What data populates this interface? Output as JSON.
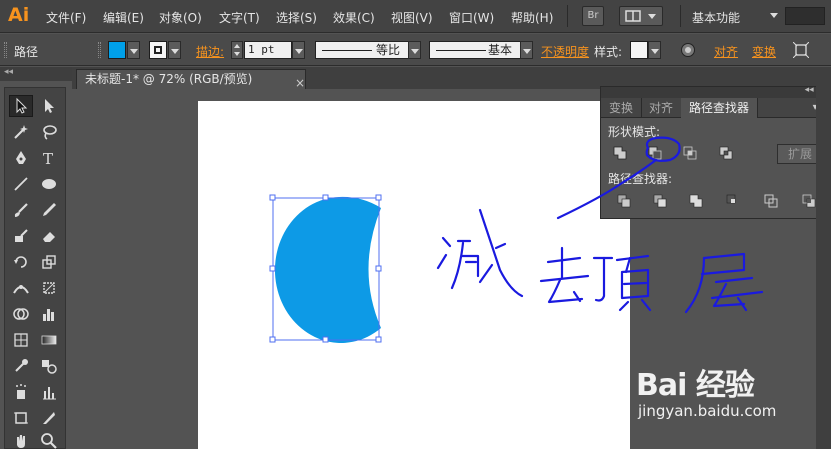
{
  "app": {
    "logo": "Ai"
  },
  "menu": {
    "items": [
      "文件(F)",
      "编辑(E)",
      "对象(O)",
      "文字(T)",
      "选择(S)",
      "效果(C)",
      "视图(V)",
      "窗口(W)",
      "帮助(H)"
    ],
    "bridge_label": "Br",
    "workspace": "基本功能"
  },
  "control_bar": {
    "selection_type": "路径",
    "fill_color": "#00a0e9",
    "stroke_label": "描边:",
    "stroke_weight": "1 pt",
    "profile_label": "等比",
    "brush_label": "基本",
    "opacity_label": "不透明度",
    "style_label": "样式:",
    "align_label": "对齐",
    "transform_label": "变换"
  },
  "document": {
    "tab_title": "未标题-1* @ 72% (RGB/预览)",
    "close": "×",
    "shape_color": "#0d9ae6"
  },
  "pathfinder": {
    "tabs": [
      "变换",
      "对齐",
      "路径查找器"
    ],
    "active_tab": 2,
    "shape_modes_title": "形状模式:",
    "pathfinders_title": "路径查找器:",
    "expand_label": "扩展",
    "shape_modes": [
      "unite-icon",
      "minus-front-icon",
      "intersect-icon",
      "exclude-icon"
    ],
    "pathfinder_ops": [
      "divide-icon",
      "trim-icon",
      "merge-icon",
      "crop-icon",
      "outline-icon",
      "minus-back-icon"
    ]
  },
  "annotation": {
    "handwritten_text": "减去顶层",
    "ink_color": "#1a1adf"
  },
  "watermark": {
    "main": "Bai 经验",
    "sub": "jingyan.baidu.com"
  }
}
